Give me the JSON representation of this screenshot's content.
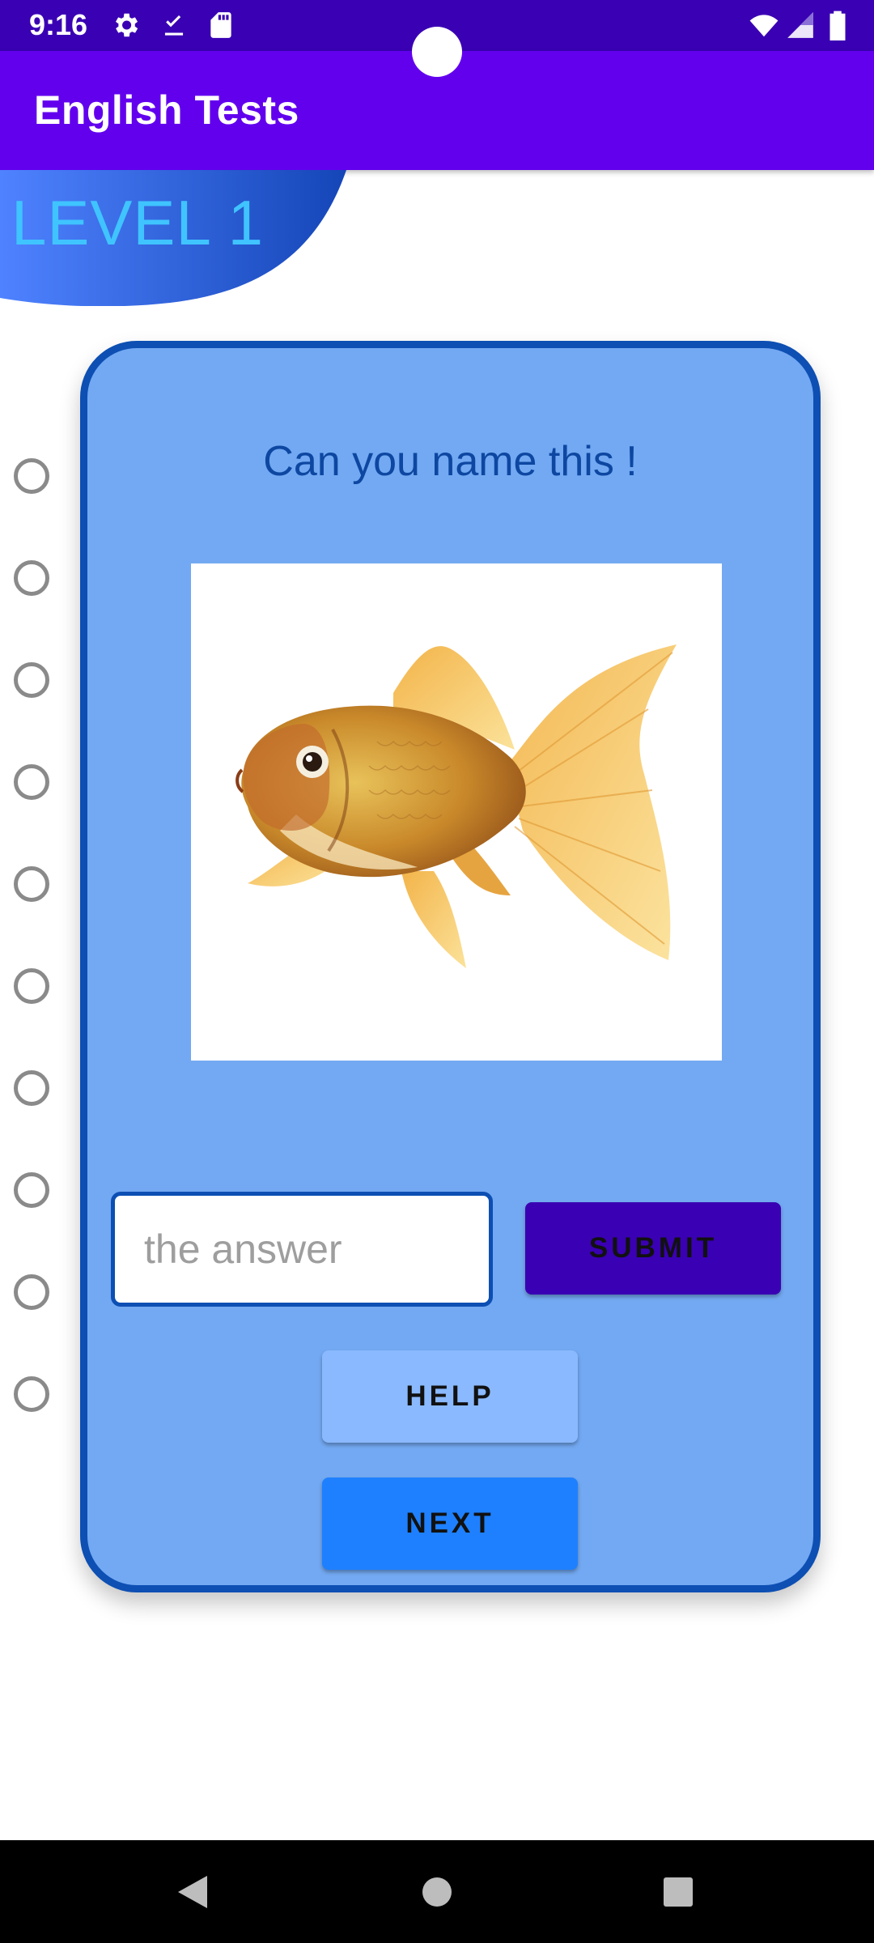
{
  "status_bar": {
    "time": "9:16",
    "icons_left": [
      "gear-icon",
      "download-done-icon",
      "sd-card-icon"
    ],
    "icons_right": [
      "wifi-icon",
      "signal-icon",
      "battery-icon"
    ]
  },
  "app_bar": {
    "title": "English Tests"
  },
  "level": {
    "label": "LEVEL 1"
  },
  "progress": {
    "total_questions": 10,
    "answered": 0
  },
  "card": {
    "question": "Can you name this !",
    "image_subject": "goldfish",
    "answer_placeholder": "the answer",
    "answer_value": "",
    "submit_label": "SUBMIT",
    "help_label": "HELP",
    "next_label": "NEXT"
  },
  "nav_bar": {
    "items": [
      "back-icon",
      "home-icon",
      "recents-icon"
    ]
  },
  "colors": {
    "status_bar": "#3a00b3",
    "app_bar": "#6200ee",
    "card_fill": "#73a9f2",
    "card_border": "#0d4fb3",
    "submit": "#3a00b3",
    "help": "#8ab9ff",
    "next": "#1e80ff",
    "level_text": "#40c4ff"
  }
}
